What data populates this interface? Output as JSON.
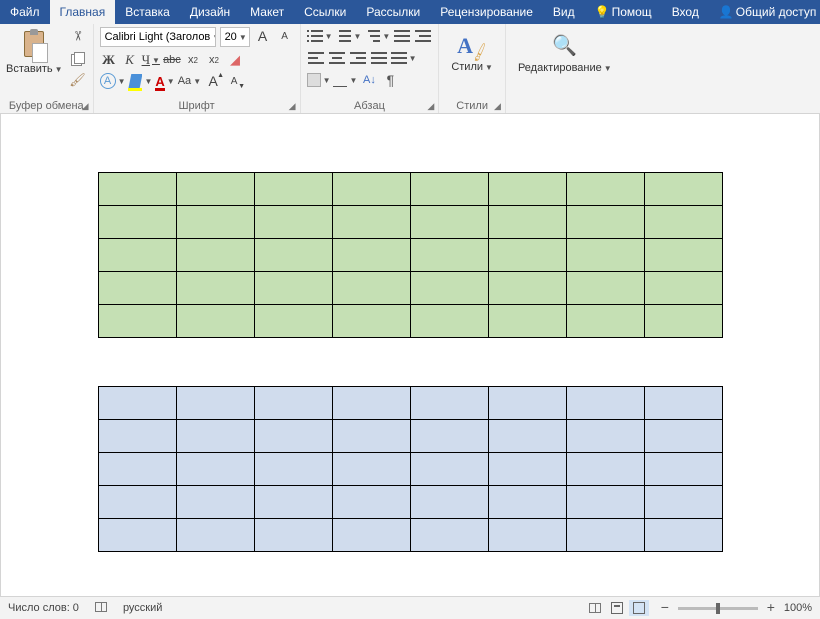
{
  "menubar": {
    "items": [
      "Файл",
      "Главная",
      "Вставка",
      "Дизайн",
      "Макет",
      "Ссылки",
      "Рассылки",
      "Рецензирование",
      "Вид"
    ],
    "active_index": 1,
    "tell_me": "Помощ",
    "sign_in": "Вход",
    "share": "Общий доступ"
  },
  "ribbon": {
    "clipboard": {
      "paste": "Вставить",
      "label": "Буфер обмена"
    },
    "font": {
      "name": "Calibri Light (Заголов",
      "size": "20",
      "label": "Шрифт",
      "bold": "Ж",
      "italic": "К",
      "underline": "Ч",
      "strike": "abc",
      "sub_base": "x",
      "case": "Aa",
      "bigA": "A",
      "smA": "A",
      "circA": "A",
      "fcolor": "A"
    },
    "paragraph": {
      "label": "Абзац"
    },
    "styles": {
      "btn": "Стили",
      "label": "Стили"
    },
    "editing": {
      "btn": "Редактирование"
    }
  },
  "document": {
    "tables": [
      {
        "rows": 5,
        "cols": 8,
        "fill": "green"
      },
      {
        "rows": 5,
        "cols": 8,
        "fill": "blue"
      }
    ]
  },
  "status": {
    "word_count": "Число слов: 0",
    "language": "русский",
    "zoom": "100%"
  }
}
